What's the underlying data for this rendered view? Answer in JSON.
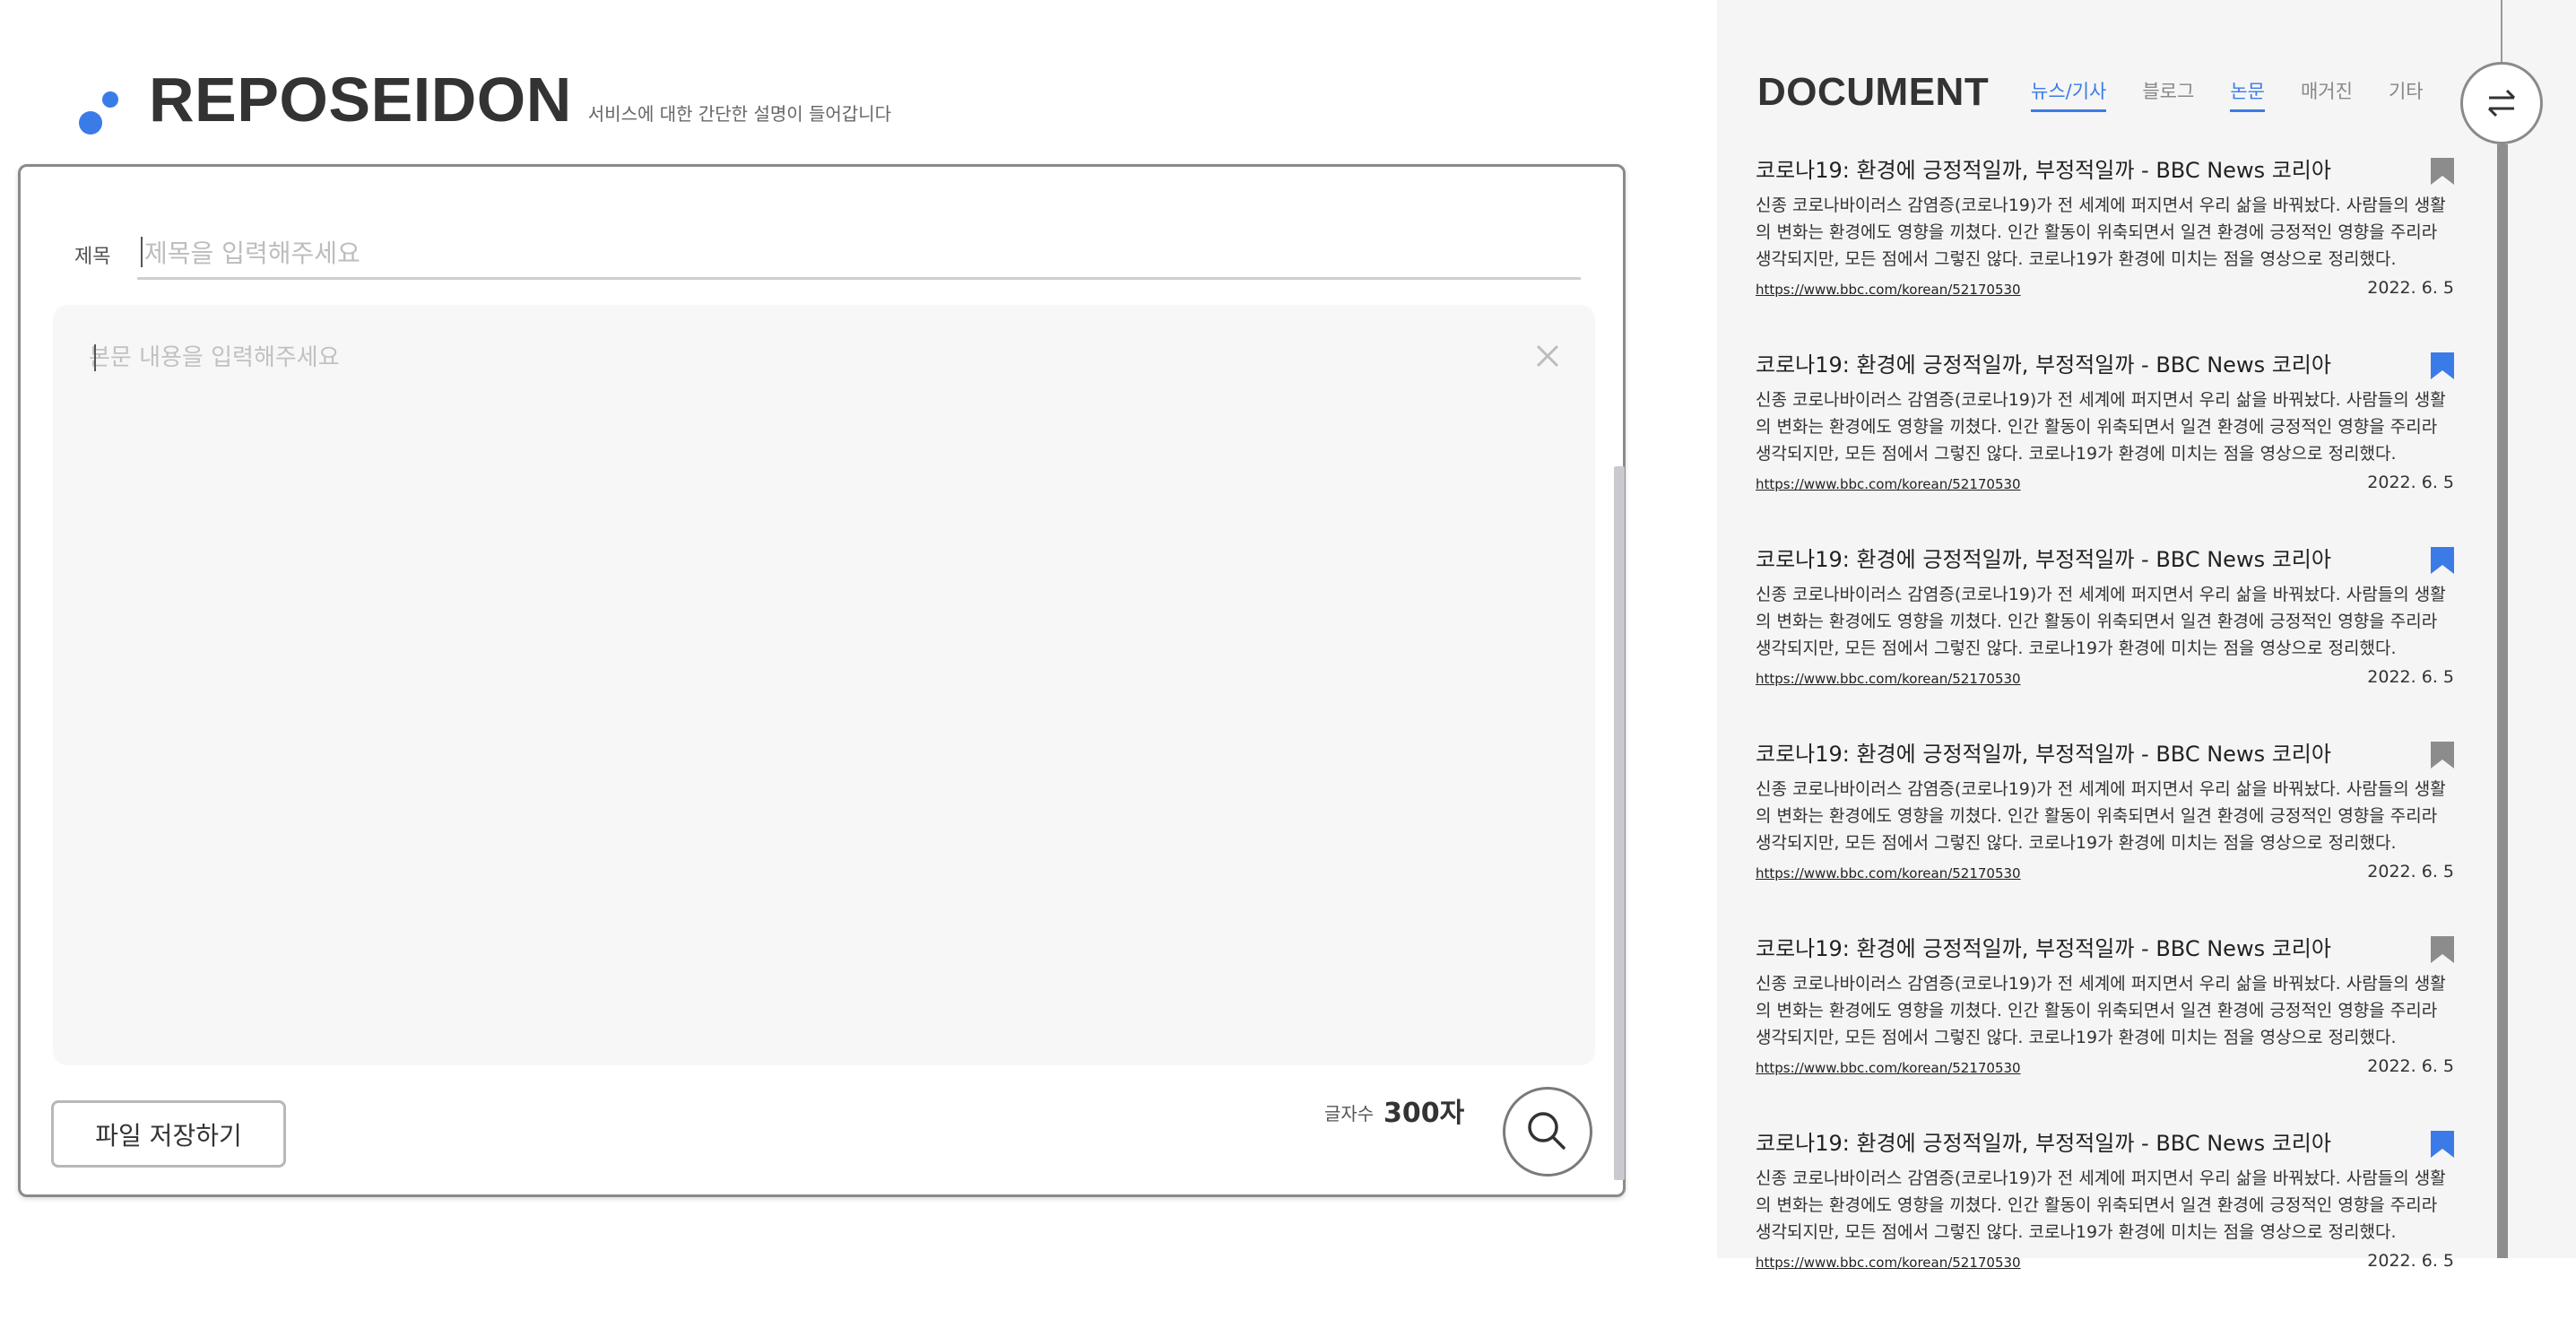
{
  "header": {
    "app_name": "REPOSEIDON",
    "description": "서비스에 대한 간단한 설명이 들어갑니다",
    "accent_color": "#3a7be8"
  },
  "editor": {
    "title_label": "제목",
    "title_placeholder": "제목을 입력해주세요",
    "body_placeholder": "본문 내용을 입력해주세요",
    "save_label": "파일 저장하기",
    "count_label": "글자수",
    "count_value": "300자"
  },
  "panel": {
    "title": "DOCUMENT",
    "tabs": [
      {
        "label": "뉴스/기사",
        "active": true
      },
      {
        "label": "블로그",
        "active": false
      },
      {
        "label": "논문",
        "active": true
      },
      {
        "label": "매거진",
        "active": false
      },
      {
        "label": "기타",
        "active": false
      }
    ],
    "documents": [
      {
        "title": "코로나19: 환경에 긍정적일까, 부정적일까 - BBC News 코리아",
        "body": "신종 코로나바이러스 감염증(코로나19)가 전 세계에 퍼지면서 우리 삶을 바꿔놨다. 사람들의 생활의 변화는 환경에도 영향을 끼쳤다. 인간 활동이 위축되면서 일견 환경에 긍정적인 영향을 주리라 생각되지만, 모든 점에서 그렇진 않다. 코로나19가 환경에 미치는 점을 영상으로 정리했다.",
        "link": "https://www.bbc.com/korean/52170530",
        "date": "2022. 6. 5",
        "bookmarked": false
      },
      {
        "title": "코로나19: 환경에 긍정적일까, 부정적일까 - BBC News 코리아",
        "body": "신종 코로나바이러스 감염증(코로나19)가 전 세계에 퍼지면서 우리 삶을 바꿔놨다. 사람들의 생활의 변화는 환경에도 영향을 끼쳤다. 인간 활동이 위축되면서 일견 환경에 긍정적인 영향을 주리라 생각되지만, 모든 점에서 그렇진 않다. 코로나19가 환경에 미치는 점을 영상으로 정리했다.",
        "link": "https://www.bbc.com/korean/52170530",
        "date": "2022. 6. 5",
        "bookmarked": true
      },
      {
        "title": "코로나19: 환경에 긍정적일까, 부정적일까 - BBC News 코리아",
        "body": "신종 코로나바이러스 감염증(코로나19)가 전 세계에 퍼지면서 우리 삶을 바꿔놨다. 사람들의 생활의 변화는 환경에도 영향을 끼쳤다. 인간 활동이 위축되면서 일견 환경에 긍정적인 영향을 주리라 생각되지만, 모든 점에서 그렇진 않다. 코로나19가 환경에 미치는 점을 영상으로 정리했다.",
        "link": "https://www.bbc.com/korean/52170530",
        "date": "2022. 6. 5",
        "bookmarked": true
      },
      {
        "title": "코로나19: 환경에 긍정적일까, 부정적일까 - BBC News 코리아",
        "body": "신종 코로나바이러스 감염증(코로나19)가 전 세계에 퍼지면서 우리 삶을 바꿔놨다. 사람들의 생활의 변화는 환경에도 영향을 끼쳤다. 인간 활동이 위축되면서 일견 환경에 긍정적인 영향을 주리라 생각되지만, 모든 점에서 그렇진 않다. 코로나19가 환경에 미치는 점을 영상으로 정리했다.",
        "link": "https://www.bbc.com/korean/52170530",
        "date": "2022. 6. 5",
        "bookmarked": false
      },
      {
        "title": "코로나19: 환경에 긍정적일까, 부정적일까 - BBC News 코리아",
        "body": "신종 코로나바이러스 감염증(코로나19)가 전 세계에 퍼지면서 우리 삶을 바꿔놨다. 사람들의 생활의 변화는 환경에도 영향을 끼쳤다. 인간 활동이 위축되면서 일견 환경에 긍정적인 영향을 주리라 생각되지만, 모든 점에서 그렇진 않다. 코로나19가 환경에 미치는 점을 영상으로 정리했다.",
        "link": "https://www.bbc.com/korean/52170530",
        "date": "2022. 6. 5",
        "bookmarked": false
      },
      {
        "title": "코로나19: 환경에 긍정적일까, 부정적일까 - BBC News 코리아",
        "body": "신종 코로나바이러스 감염증(코로나19)가 전 세계에 퍼지면서 우리 삶을 바꿔놨다. 사람들의 생활의 변화는 환경에도 영향을 끼쳤다. 인간 활동이 위축되면서 일견 환경에 긍정적인 영향을 주리라 생각되지만, 모든 점에서 그렇진 않다. 코로나19가 환경에 미치는 점을 영상으로 정리했다.",
        "link": "https://www.bbc.com/korean/52170530",
        "date": "2022. 6. 5",
        "bookmarked": true
      }
    ]
  },
  "colors": {
    "bookmark_on": "#3a7be8",
    "bookmark_off": "#8c8c8c"
  },
  "icons": {
    "logo": "logo-dots-icon",
    "clear": "close-icon",
    "search": "search-icon",
    "toggle": "swap-arrows-icon",
    "bookmark": "bookmark-icon"
  }
}
